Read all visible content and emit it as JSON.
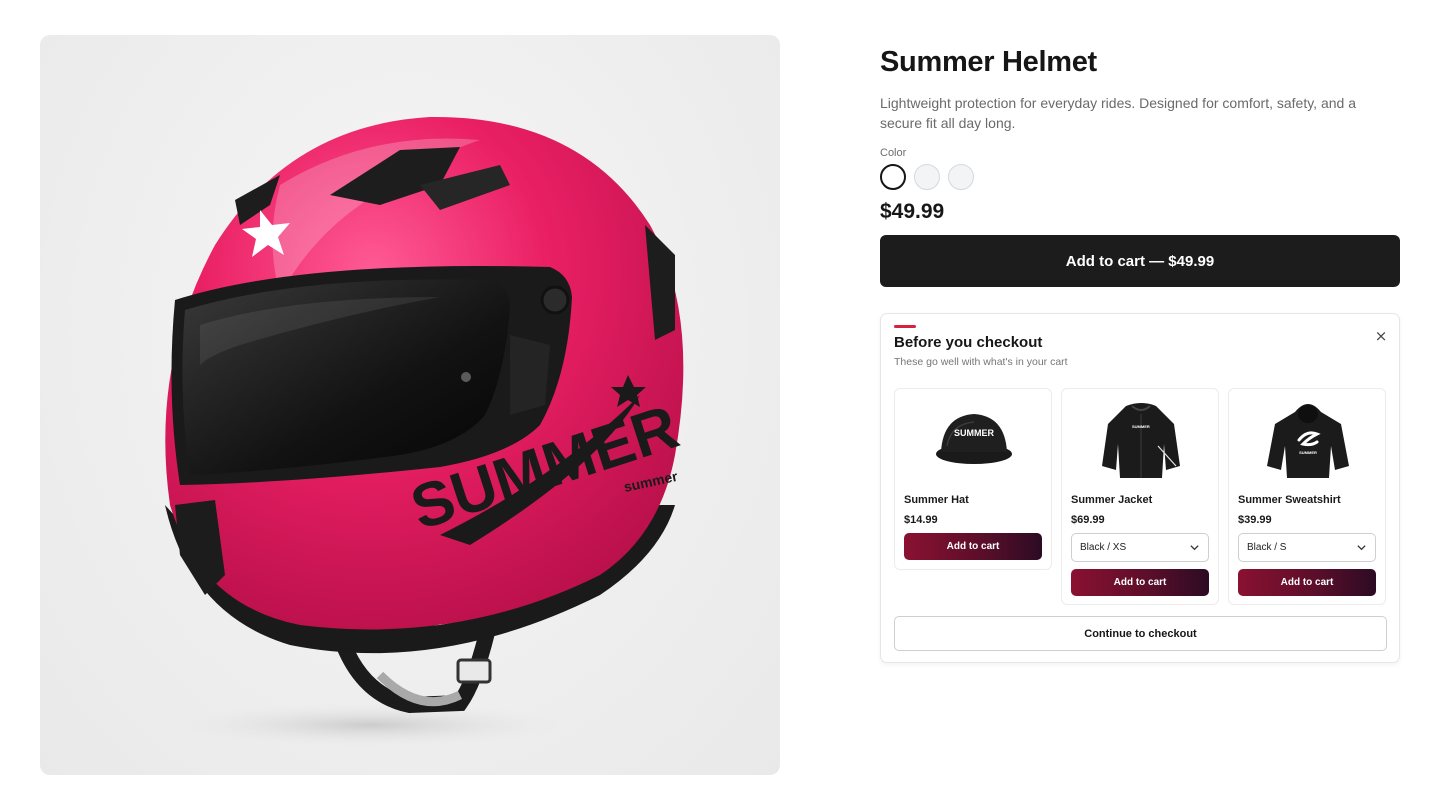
{
  "product": {
    "title": "Summer Helmet",
    "description": "Lightweight protection for everyday rides. Designed for comfort, safety, and a secure fit all day long.",
    "color_label": "Color",
    "color_swatches": [
      {
        "selected": true
      },
      {
        "selected": false
      },
      {
        "selected": false
      }
    ],
    "price": "$49.99",
    "add_to_cart_label": "Add to cart — $49.99",
    "image": {
      "icon": "pink-motorcycle-helmet",
      "helmet_wordmark": "SUMMER",
      "helmet_small_mark": "summer",
      "helmet_color": "#ea1f64"
    }
  },
  "upsell": {
    "title": "Before you checkout",
    "subtitle": "These go well with what's in your cart",
    "close_icon": "×",
    "accent_color": "#d6223f",
    "items": [
      {
        "name": "Summer Hat",
        "price": "$14.99",
        "variant": null,
        "add_label": "Add to cart",
        "thumb_icon": "black-cap",
        "thumb_text": "SUMMER"
      },
      {
        "name": "Summer Jacket",
        "price": "$69.99",
        "variant": "Black / XS",
        "add_label": "Add to cart",
        "thumb_icon": "black-jacket",
        "thumb_text": "SUMMER"
      },
      {
        "name": "Summer Sweatshirt",
        "price": "$39.99",
        "variant": "Black / S",
        "add_label": "Add to cart",
        "thumb_icon": "black-hoodie",
        "thumb_text": "SUMMER"
      }
    ],
    "continue_label": "Continue to checkout"
  }
}
